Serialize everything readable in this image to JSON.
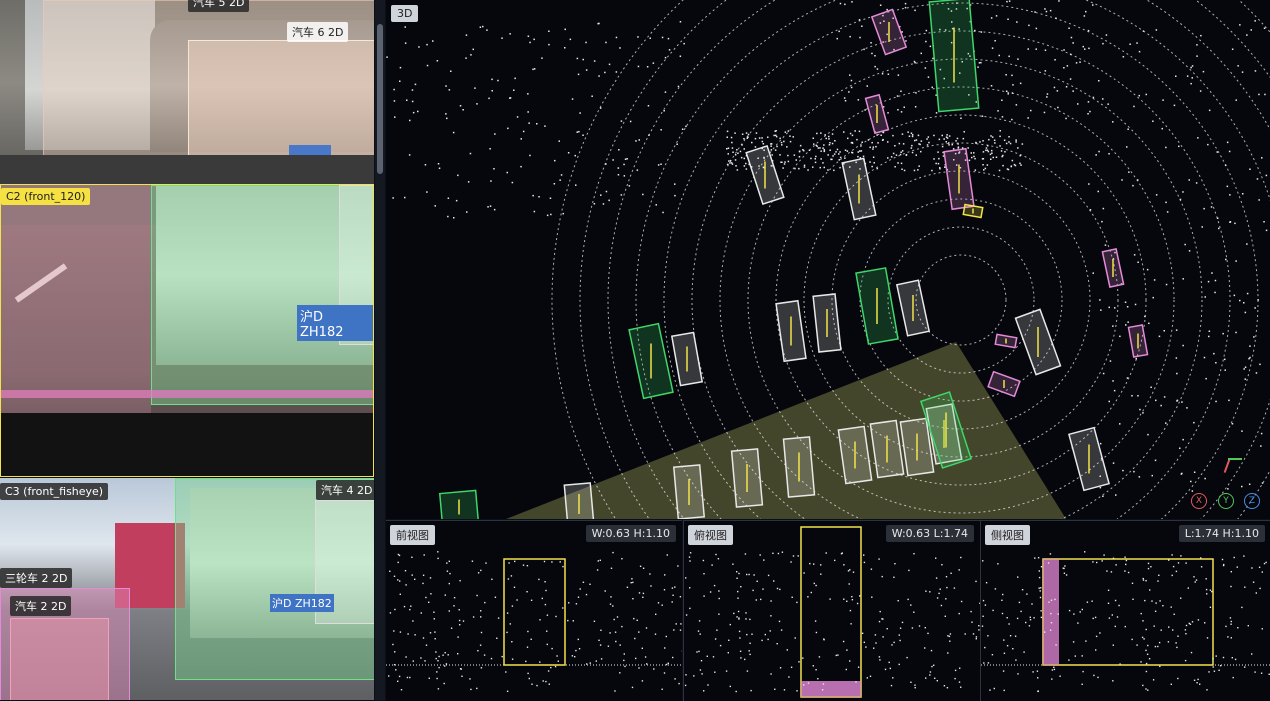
{
  "cameras": {
    "c1": {
      "label_top": "汽车 5 2D",
      "label_car6": "汽车 6 2D"
    },
    "c2": {
      "title": "C2 (front_120)",
      "plate": "沪D ZH182"
    },
    "c3": {
      "title": "C3 (front_fisheye)",
      "label_car4": "汽车 4 2D",
      "label_tricycle": "三轮车 2 2D",
      "label_car2": "汽车 2 2D",
      "plate": "沪D ZH182"
    }
  },
  "view3d": {
    "tag": "3D",
    "axes": {
      "x": "X",
      "y": "Y",
      "z": "Z"
    },
    "colors": {
      "cyan": "#e8e8e8",
      "green": "#3fd66b",
      "pink": "#e58ad8",
      "yellow": "#f2e24b",
      "sector": "#e7ea7a"
    }
  },
  "panels": {
    "front": {
      "tag": "前视图",
      "dims": "W:0.63 H:1.10"
    },
    "top": {
      "tag": "俯视图",
      "dims": "W:0.63 L:1.74"
    },
    "side": {
      "tag": "侧视图",
      "dims": "L:1.74 H:1.10"
    }
  }
}
